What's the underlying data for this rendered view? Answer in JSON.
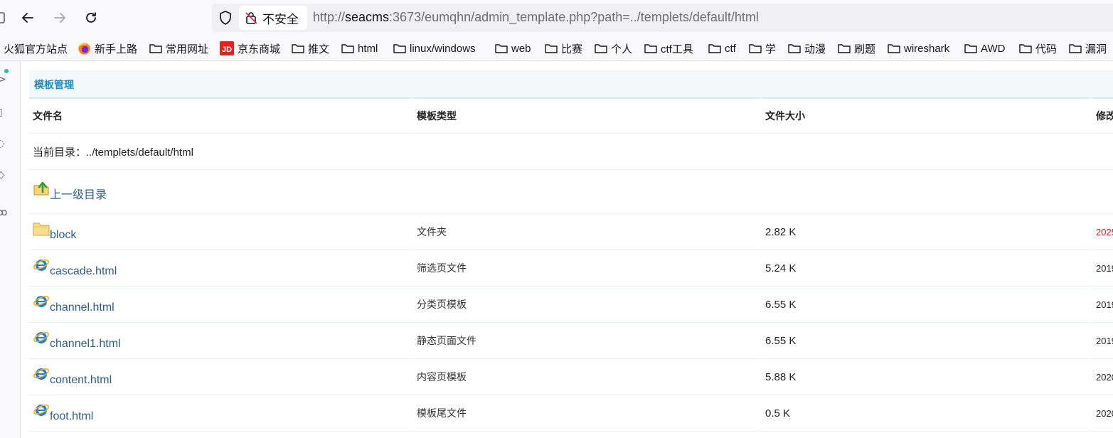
{
  "browser": {
    "insecure_label": "不安全",
    "url_prefix": "http://",
    "url_host": "seacms",
    "url_rest": ":3673/eumqhn/admin_template.php?path=../templets/default/html"
  },
  "bookmarks": [
    {
      "label": "火狐官方站点",
      "icon": "none"
    },
    {
      "label": "新手上路",
      "icon": "firefox-icon"
    },
    {
      "label": "常用网址",
      "icon": "folder-icon"
    },
    {
      "label": "京东商城",
      "icon": "jd-icon"
    },
    {
      "label": "推文",
      "icon": "folder-icon"
    },
    {
      "label": "html",
      "icon": "folder-icon"
    },
    {
      "label": "linux/windows",
      "icon": "folder-icon"
    },
    {
      "label": "web",
      "icon": "folder-icon"
    },
    {
      "label": "比赛",
      "icon": "folder-icon"
    },
    {
      "label": "个人",
      "icon": "folder-icon"
    },
    {
      "label": "ctf工具",
      "icon": "folder-icon"
    },
    {
      "label": "ctf",
      "icon": "folder-icon"
    },
    {
      "label": "学",
      "icon": "folder-icon"
    },
    {
      "label": "动漫",
      "icon": "folder-icon"
    },
    {
      "label": "刷题",
      "icon": "folder-icon"
    },
    {
      "label": "wireshark",
      "icon": "folder-icon"
    },
    {
      "label": "AWD",
      "icon": "folder-icon"
    },
    {
      "label": "代码",
      "icon": "folder-icon"
    },
    {
      "label": "漏洞",
      "icon": "folder-icon"
    }
  ],
  "panel": {
    "title": "模板管理",
    "columns": [
      "文件名",
      "模板类型",
      "文件大小",
      "修改"
    ],
    "current_dir_label": "当前目录：../templets/default/html",
    "parent_dir_label": "上一级目录",
    "rows": [
      {
        "name": "block",
        "icon": "folder-icon",
        "type": "文件夹",
        "size": "2.82 K",
        "date": "2025",
        "highlight": true
      },
      {
        "name": "cascade.html",
        "icon": "ie-icon",
        "type": "筛选页文件",
        "size": "5.24 K",
        "date": "2019",
        "highlight": false
      },
      {
        "name": "channel.html",
        "icon": "ie-icon",
        "type": "分类页模板",
        "size": "6.55 K",
        "date": "2019",
        "highlight": false
      },
      {
        "name": "channel1.html",
        "icon": "ie-icon",
        "type": "静态页面文件",
        "size": "6.55 K",
        "date": "2019",
        "highlight": false
      },
      {
        "name": "content.html",
        "icon": "ie-icon",
        "type": "内容页模板",
        "size": "5.88 K",
        "date": "2020",
        "highlight": false
      },
      {
        "name": "foot.html",
        "icon": "ie-icon",
        "type": "模板尾文件",
        "size": "0.5 K",
        "date": "2020",
        "highlight": false
      }
    ]
  }
}
